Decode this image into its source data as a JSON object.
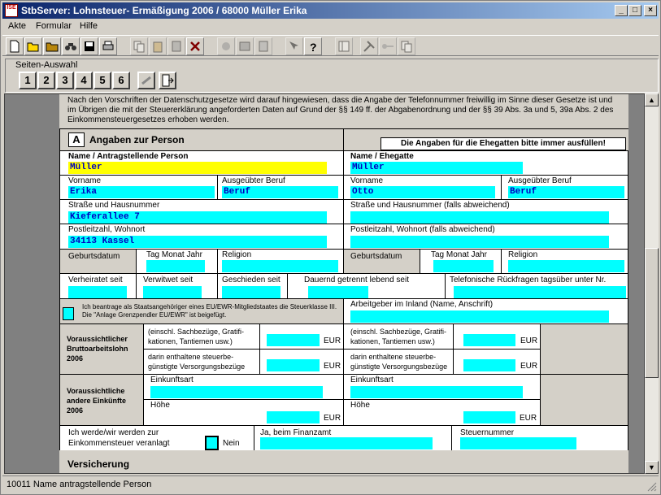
{
  "window": {
    "title": "StbServer: Lohnsteuer- Ermäßigung 2006 / 68000 Müller Erika",
    "app_icon_text": "ISE",
    "min": "_",
    "max": "□",
    "close": "×"
  },
  "menu": [
    "Akte",
    "Formular",
    "Hilfe"
  ],
  "toolbar_icons": [
    "new-icon",
    "open-icon",
    "folder-icon",
    "binoculars-icon",
    "save-icon",
    "print-icon",
    "copy-icon",
    "paste-icon",
    "calculator-icon",
    "delete-icon",
    "stamp-icon",
    "book-icon",
    "notes-icon",
    "help-context-icon",
    "help-icon",
    "window-icon",
    "tools-icon",
    "key-icon",
    "pages-icon"
  ],
  "page_select": {
    "label": "Seiten-Auswahl",
    "pages": [
      "1",
      "2",
      "3",
      "4",
      "5",
      "6"
    ]
  },
  "form": {
    "notice": "Nach den Vorschriften der Datenschutzgesetze wird darauf hingewiesen, dass die Angabe der Telefonnummer freiwillig im Sinne dieser Gesetze ist und im Übrigen die mit der Steuererklärung angeforderten Daten auf Grund der §§ 149 ff. der Abgabenordnung und der §§ 39 Abs. 3a und 5, 39a Abs. 2 des Einkommensteuergesetzes erhoben werden.",
    "section_letter": "A",
    "section_title": "Angaben zur Person",
    "spouse_hint": "Die Angaben für die Ehegatten bitte immer ausfüllen!",
    "l_name": "Name / Antragstellende Person",
    "v_name": "Müller",
    "r_name": "Name / Ehegatte",
    "v_rname": "Müller",
    "l_vorname": "Vorname",
    "v_vorname": "Erika",
    "v_rvorname": "Otto",
    "l_beruf": "Ausgeübter Beruf",
    "v_beruf": "Beruf",
    "v_rberuf": "Beruf",
    "l_strasse": "Straße und Hausnummer",
    "v_strasse": "Kieferallee 7",
    "r_strasse": "Straße und Hausnummer (falls abweichend)",
    "l_plz": "Postleitzahl, Wohnort",
    "v_plz": "34113 Kassel",
    "r_plz": "Postleitzahl, Wohnort (falls abweichend)",
    "l_geb": "Geburtsdatum",
    "l_tmj": "Tag Monat Jahr",
    "l_religion": "Religion",
    "l_verh": "Verheiratet seit",
    "l_verw": "Verwitwet seit",
    "l_gesch": "Geschieden seit",
    "l_dauernd": "Dauernd getrennt lebend seit",
    "l_tel": "Telefonische Rückfragen tagsüber unter Nr.",
    "eu_text": "Ich beantrage als Staatsangehöriger eines EU/EWR-Mitgliedstaates die Steuerklasse III. Die \"Anlage Grenzpendler EU/EWR\" ist beigefügt.",
    "l_arbeitgeber": "Arbeitgeber im Inland (Name, Anschrift)",
    "l_brutto": "Voraussichtlicher Bruttoarbeitslohn 2006",
    "l_sach1": "(einschl. Sachbezüge, Gratifi-",
    "l_sach2": "kationen, Tantiemen usw.)",
    "l_vers1": "darin enthaltene steuerbe-",
    "l_vers2": "günstigte Versorgungsbezüge",
    "eur": "EUR",
    "l_andere": "Voraussichtliche andere Einkünfte 2006",
    "l_einkunft": "Einkunftsart",
    "l_hoehe": "Höhe",
    "l_veranl1": "Ich werde/wir werden zur",
    "l_veranl2": "Einkommensteuer veranlagt",
    "l_nein": "Nein",
    "l_ja": "Ja, beim Finanzamt",
    "l_steuernr": "Steuernummer",
    "l_versicherung": "Versicherung"
  },
  "status": "10011 Name antragstellende Person"
}
